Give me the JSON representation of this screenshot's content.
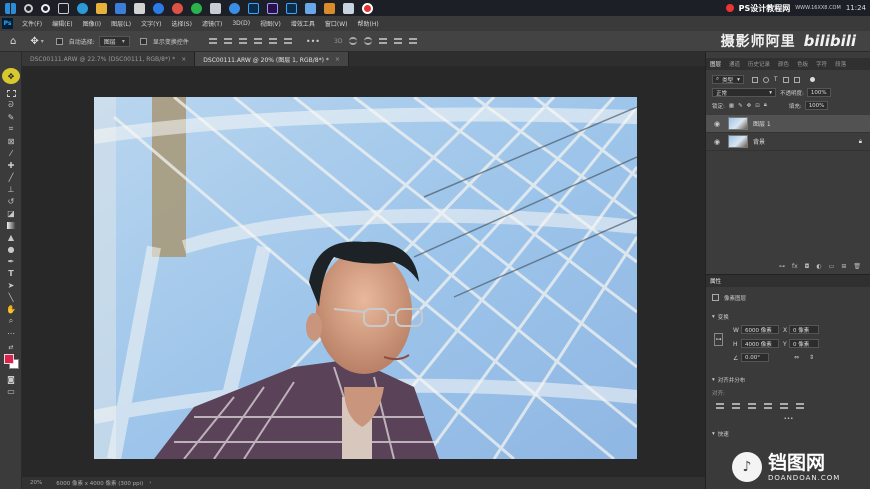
{
  "taskbar": {
    "right": {
      "overlay_text": "PS设计教程网",
      "url": "WWW.16XX8.COM",
      "time": "11:24"
    }
  },
  "menubar": {
    "app_icon": "Ps",
    "items": [
      "文件(F)",
      "编辑(E)",
      "图像(I)",
      "图层(L)",
      "文字(Y)",
      "选择(S)",
      "滤镜(T)",
      "3D(D)",
      "视图(V)",
      "增效工具",
      "窗口(W)",
      "帮助(H)"
    ]
  },
  "optionsbar": {
    "auto_select_label": "自动选择:",
    "auto_select_value": "图层",
    "show_transform_label": "显示变换控件",
    "more": "•••"
  },
  "watermark": {
    "channel_text": "摄影师阿里",
    "platform_text": "bilibili"
  },
  "tabs": [
    {
      "label": "DSC00111.ARW @ 22.7% (DSC00111, RGB/8*) *"
    },
    {
      "label": "DSC00111.ARW @ 20% (图层 1, RGB/8*) *"
    }
  ],
  "status": {
    "zoom": "20%",
    "doc_info": "6000 像素 x 4000 像素 (300 ppi)"
  },
  "layers_panel": {
    "tabs": [
      "图层",
      "通道",
      "历史记录",
      "颜色",
      "色板",
      "字符",
      "段落"
    ],
    "kind_label": "类型",
    "blend_mode": "正常",
    "opacity_label": "不透明度:",
    "opacity_value": "100%",
    "lock_label": "锁定:",
    "fill_label": "填充:",
    "fill_value": "100%",
    "layers": [
      {
        "name": "图层 1",
        "selected": true,
        "locked": false
      },
      {
        "name": "背景",
        "selected": false,
        "locked": true
      }
    ],
    "footer_icons": [
      "link-icon",
      "fx-icon",
      "mask-icon",
      "adjustment-icon",
      "group-icon",
      "new-layer-icon",
      "trash-icon"
    ]
  },
  "properties_panel": {
    "title": "属性",
    "type_label": "像素图层",
    "transform_section": "变换",
    "w_label": "W",
    "w_value": "6000 像素",
    "h_label": "H",
    "h_value": "4000 像素",
    "x_label": "X",
    "x_value": "0 像素",
    "y_label": "Y",
    "y_value": "0 像素",
    "angle_value": "0.00°",
    "align_section": "对齐并分布",
    "align_label": "对齐:",
    "more": "•••",
    "quick_actions": "快速"
  },
  "bottom_watermark": {
    "brand": "铛图网",
    "url": "DOANDOAN.COM"
  },
  "colors": {
    "foreground": "#e0204d",
    "background": "#ffffff",
    "move_tool": "#d7c830",
    "accent": "#2d8cd6"
  }
}
